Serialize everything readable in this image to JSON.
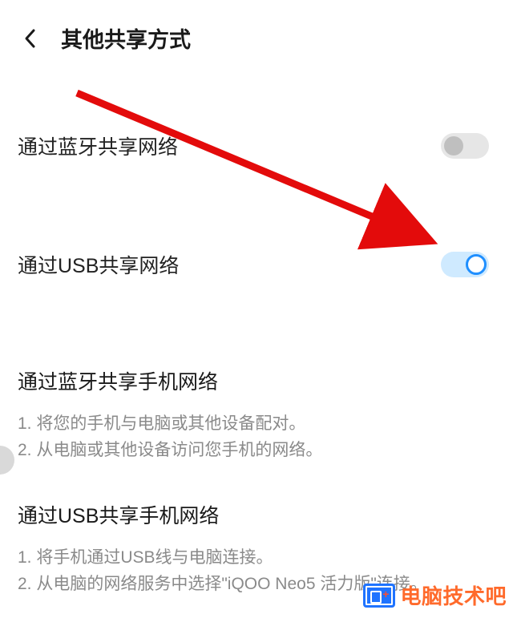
{
  "header": {
    "title": "其他共享方式"
  },
  "rows": {
    "bluetooth": {
      "label": "通过蓝牙共享网络",
      "on": false
    },
    "usb": {
      "label": "通过USB共享网络",
      "on": true
    }
  },
  "sections": {
    "bt_help": {
      "title": "通过蓝牙共享手机网络",
      "line1": "1. 将您的手机与电脑或其他设备配对。",
      "line2": "2. 从电脑或其他设备访问您手机的网络。"
    },
    "usb_help": {
      "title": "通过USB共享手机网络",
      "line1": "1. 将手机通过USB线与电脑连接。",
      "line2": "2. 从电脑的网络服务中选择\"iQOO Neo5 活力版\"连接。"
    }
  },
  "annotation": {
    "arrow_color": "#e30b0b"
  },
  "watermark": {
    "text": "电脑技术吧"
  }
}
